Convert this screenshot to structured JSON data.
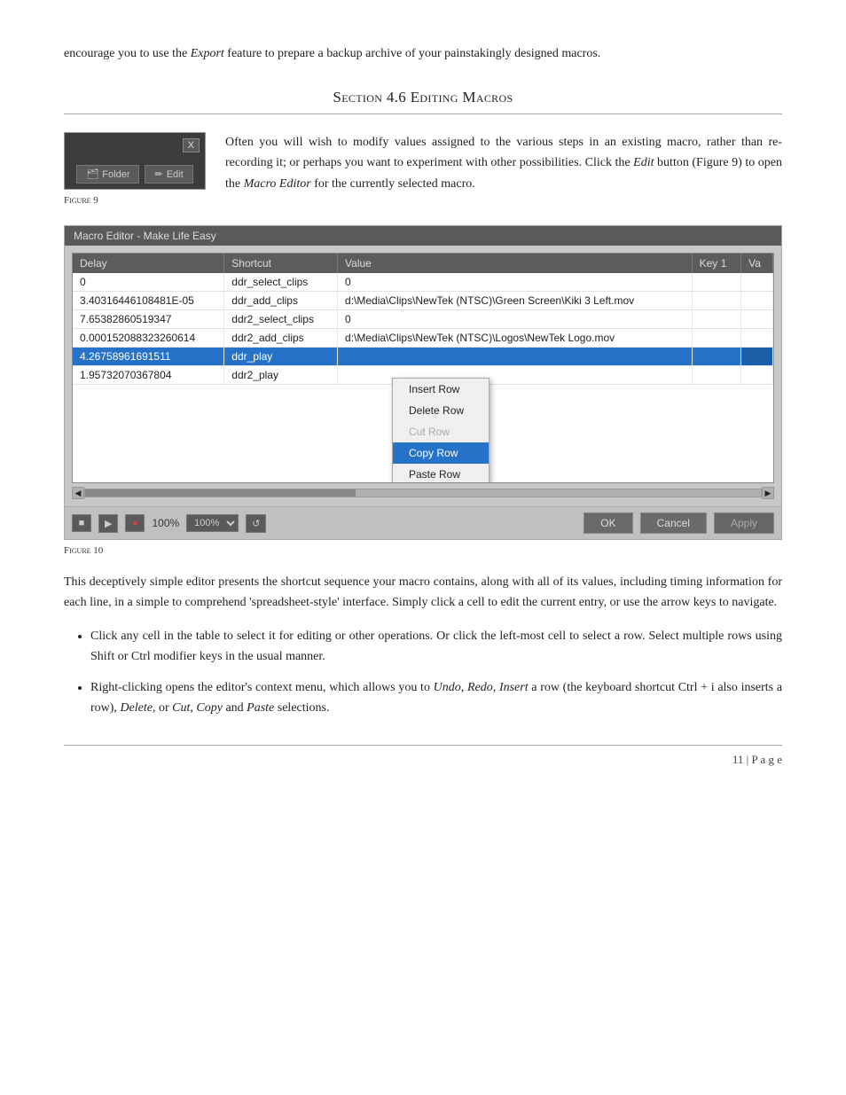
{
  "intro": {
    "text": "encourage you to use the ",
    "export_word": "Export",
    "text2": " feature to prepare a backup archive of your painstakingly designed macros."
  },
  "section": {
    "number": "Section 4.6",
    "title": "Editing Macros"
  },
  "figure9": {
    "caption": "Figure 9",
    "close_label": "X",
    "folder_label": "Folder",
    "edit_label": "Edit"
  },
  "figure9_body": {
    "text1": "Often you will wish to modify values assigned to the various steps in an existing macro, rather than re-recording it; or perhaps you want to experiment with other possibilities. Click the ",
    "edit_italic": "Edit",
    "text2": " button (Figure 9) to open the ",
    "macro_editor_italic": "Macro Editor",
    "text3": " for the currently selected macro."
  },
  "macro_editor": {
    "title": "Macro Editor - Make Life Easy",
    "columns": [
      "Delay",
      "Shortcut",
      "Value",
      "Key 1",
      "Va"
    ],
    "rows": [
      {
        "delay": "0",
        "shortcut": "ddr_select_clips",
        "value": "0",
        "key1": "",
        "va": ""
      },
      {
        "delay": "3.40316446108481E-05",
        "shortcut": "ddr_add_clips",
        "value": "d:\\Media\\Clips\\NewTek (NTSC)\\Green Screen\\Kiki 3 Left.mov",
        "key1": "",
        "va": ""
      },
      {
        "delay": "7.65382860519347",
        "shortcut": "ddr2_select_clips",
        "value": "0",
        "key1": "",
        "va": ""
      },
      {
        "delay": "0.000152088323260614",
        "shortcut": "ddr2_add_clips",
        "value": "d:\\Media\\Clips\\NewTek (NTSC)\\Logos\\NewTek Logo.mov",
        "key1": "",
        "va": ""
      },
      {
        "delay": "4.26758961691511",
        "shortcut": "ddr_play",
        "value": "",
        "key1": "",
        "va": "",
        "selected": true
      },
      {
        "delay": "1.95732070367804",
        "shortcut": "ddr2_play",
        "value": "",
        "key1": "",
        "va": ""
      }
    ],
    "context_menu": {
      "items": [
        {
          "label": "Insert Row",
          "state": "normal"
        },
        {
          "label": "Delete Row",
          "state": "normal"
        },
        {
          "label": "Cut Row",
          "state": "disabled"
        },
        {
          "label": "Copy Row",
          "state": "active"
        },
        {
          "label": "Paste Row",
          "state": "normal"
        }
      ]
    },
    "toolbar": {
      "stop_label": "■",
      "play_label": "▶",
      "record_label": "●",
      "zoom_label": "100%",
      "refresh_label": "↺",
      "ok_label": "OK",
      "cancel_label": "Cancel",
      "apply_label": "Apply"
    }
  },
  "figure10": {
    "caption": "Figure 10"
  },
  "body_para1": "This deceptively simple editor presents the shortcut sequence your macro contains, along with all of its values, including timing information for each line, in a simple to comprehend 'spreadsheet-style' interface. Simply click a cell to edit the current entry, or use the arrow keys to navigate.",
  "bullets": [
    {
      "text1": "Click any cell in the table to select it for editing or other operations.  Or click the left-most cell to select a row.  Select multiple rows using Shift or Ctrl modifier keys in the usual manner."
    },
    {
      "text1": "Right-clicking opens the editor's context menu, which allows you to ",
      "undo_italic": "Undo",
      "comma1": ", ",
      "redo_italic": "Redo",
      "comma2": ", ",
      "insert_italic": "Insert",
      "text2": " a row (the keyboard shortcut Ctrl + i also inserts a row), ",
      "delete_italic": "Delete",
      "text3": ", or ",
      "cut_italic": "Cut",
      "comma3": ", ",
      "copy_italic": "Copy",
      "text4": " and ",
      "paste_italic": "Paste",
      "text5": " selections."
    }
  ],
  "footer": {
    "page_num": "11",
    "page_label": "| P a g e"
  }
}
